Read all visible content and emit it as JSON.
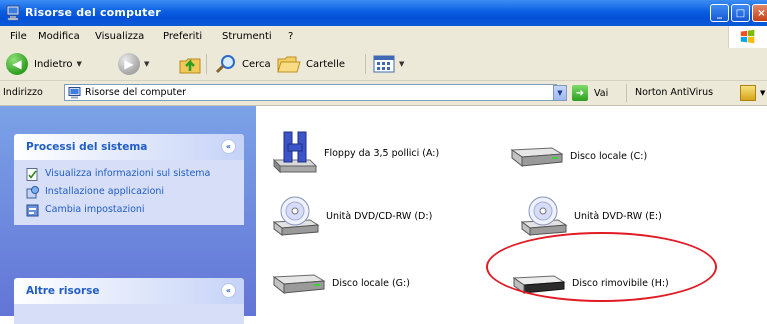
{
  "window": {
    "title": "Risorse del computer",
    "controls": [
      "_",
      "□",
      "×"
    ]
  },
  "menubar": {
    "items": [
      {
        "label": "File"
      },
      {
        "label": "Modifica"
      },
      {
        "label": "Visualizza"
      },
      {
        "label": "Preferiti"
      },
      {
        "label": "Strumenti"
      },
      {
        "label": "?"
      }
    ]
  },
  "toolbar": {
    "back_label": "Indietro",
    "search_label": "Cerca",
    "folders_label": "Cartelle"
  },
  "address": {
    "label": "Indirizzo",
    "value": "Risorse del computer",
    "go_label": "Vai",
    "norton_label": "Norton AntiVirus"
  },
  "left_pane": {
    "system_tasks": {
      "title": "Processi del sistema",
      "toggle": "«",
      "items": [
        {
          "label": "Visualizza informazioni sul sistema",
          "icon": "system-info-icon"
        },
        {
          "label": "Installazione applicazioni",
          "icon": "add-remove-icon"
        },
        {
          "label": "Cambia impostazioni",
          "icon": "control-panel-icon"
        }
      ]
    },
    "other_places": {
      "title": "Altre risorse",
      "toggle": "«"
    }
  },
  "drives": [
    {
      "label": "Floppy da 3,5 pollici (A:)",
      "icon": "floppy-drive-icon"
    },
    {
      "label": "Disco locale (C:)",
      "icon": "hard-disk-icon"
    },
    {
      "label": "Unità DVD/CD-RW (D:)",
      "icon": "cd-drive-icon"
    },
    {
      "label": "Unità DVD-RW (E:)",
      "icon": "cd-drive-icon"
    },
    {
      "label": "Disco locale (G:)",
      "icon": "hard-disk-icon"
    },
    {
      "label": "Disco rimovibile (H:)",
      "icon": "removable-disk-icon"
    }
  ],
  "colors": {
    "titlebar": "#0a5ee0",
    "task_link": "#215dc6",
    "highlight": "#e01b24"
  }
}
